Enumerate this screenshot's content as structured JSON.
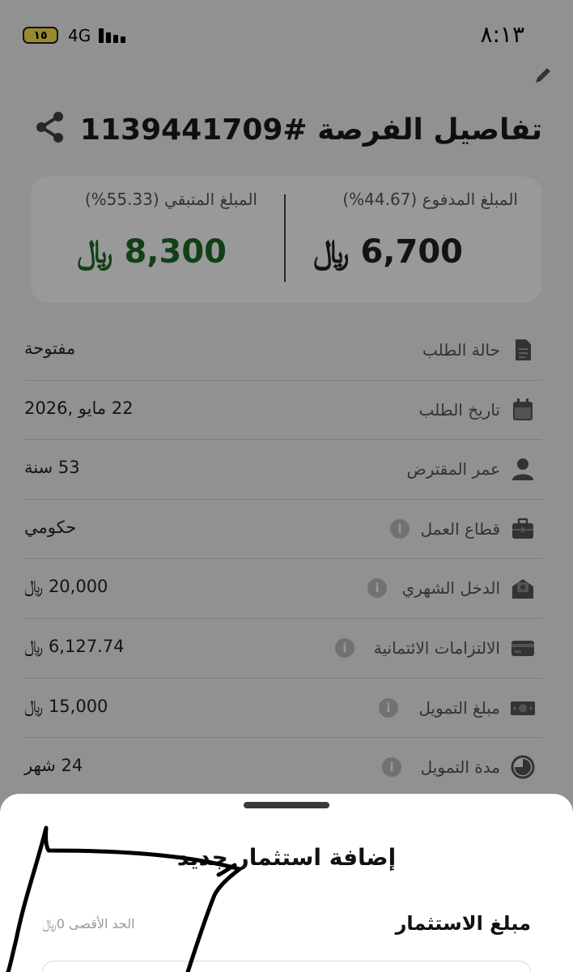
{
  "status_bar": {
    "time": "٨:١٣",
    "battery": "١٥",
    "network": "4G"
  },
  "header": {
    "title": "تفاصيل الفرصة #1139441709"
  },
  "summary": {
    "paid_label": "المبلغ المدفوع (44.67%)",
    "paid_amount": "6,700 ﷼",
    "remaining_label": "المبلغ المتبقي (55.33%)",
    "remaining_amount": "8,300 ﷼"
  },
  "details": [
    {
      "label": "حالة الطلب",
      "value": "مفتوحة",
      "icon": "document-icon",
      "info": false
    },
    {
      "label": "تاريخ الطلب",
      "value": "22 مايو ,2026",
      "icon": "calendar-icon",
      "info": false
    },
    {
      "label": "عمر المقترض",
      "value": "53 سنة",
      "icon": "person-icon",
      "info": false
    },
    {
      "label": "قطاع العمل",
      "value": "حكومي",
      "icon": "briefcase-icon",
      "info": true
    },
    {
      "label": "الدخل الشهري",
      "value": "20,000 ﷼",
      "icon": "income-icon",
      "info": true
    },
    {
      "label": "الالتزامات الائتمانية",
      "value": "6,127.74 ﷼",
      "icon": "credit-card-icon",
      "info": true
    },
    {
      "label": "مبلغ التمويل",
      "value": "15,000 ﷼",
      "icon": "cash-icon",
      "info": true
    },
    {
      "label": "مدة التمويل",
      "value": "24 شهر",
      "icon": "clock-icon",
      "info": true
    }
  ],
  "sheet": {
    "title": "إضافة استثمار جديد",
    "amount_label": "مبلغ الاستثمار",
    "max_label": "الحد الأقصى 0﷼"
  },
  "colors": {
    "remaining_amount": "#1d6b26",
    "overlay": "rgba(0,0,0,0.40)",
    "battery": "#ffe84c"
  }
}
